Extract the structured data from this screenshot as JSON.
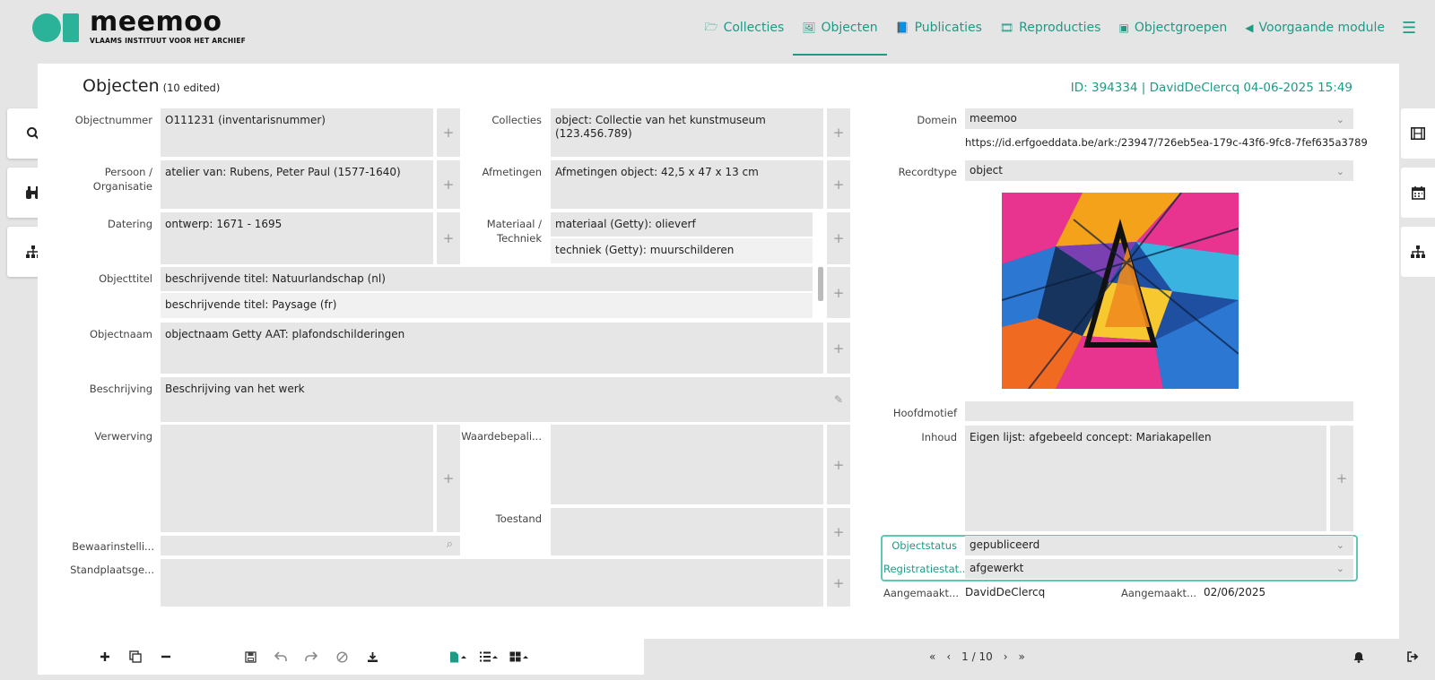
{
  "brand": {
    "name": "meemoo",
    "subtitle": "VLAAMS INSTITUUT VOOR HET ARCHIEF",
    "color": "#2bb39a"
  },
  "nav": {
    "items": [
      {
        "label": "Collecties",
        "icon": "folder-open-icon",
        "glyph": "🗁"
      },
      {
        "label": "Objecten",
        "icon": "image-icon",
        "glyph": "🖼",
        "active": true
      },
      {
        "label": "Publicaties",
        "icon": "book-icon",
        "glyph": "📘"
      },
      {
        "label": "Reproducties",
        "icon": "film-icon",
        "glyph": "🎞"
      },
      {
        "label": "Objectgroepen",
        "icon": "object-group-icon",
        "glyph": "▣"
      },
      {
        "label": "Voorgaande module",
        "icon": "arrow-circle-left-icon",
        "glyph": "◀"
      }
    ],
    "menu_glyph": "☰"
  },
  "card": {
    "title": "Objecten",
    "edited": "(10 edited)",
    "record_info": "ID: 394334 | DavidDeClercq 04-06-2025 15:49"
  },
  "fields": {
    "objectnummer": {
      "label": "Objectnummer",
      "value": "O111231 (inventarisnummer)"
    },
    "persoon": {
      "label1": "Persoon /",
      "label2": "Organisatie",
      "value": "atelier van: Rubens, Peter Paul (1577-1640)"
    },
    "datering": {
      "label": "Datering",
      "value": "ontwerp: 1671 - 1695"
    },
    "collecties": {
      "label": "Collecties",
      "value": "object: Collectie van het kunstmuseum (123.456.789)"
    },
    "afmetingen": {
      "label": "Afmetingen",
      "value": "Afmetingen object: 42,5 x 47 x 13 cm"
    },
    "materiaal": {
      "label1": "Materiaal /",
      "label2": "Techniek",
      "values": [
        "materiaal (Getty): olieverf",
        "techniek (Getty): muurschilderen"
      ]
    },
    "objecttitel": {
      "label": "Objecttitel",
      "values": [
        "beschrijvende titel: Natuurlandschap (nl)",
        "beschrijvende titel: Paysage (fr)"
      ]
    },
    "objectnaam": {
      "label": "Objectnaam",
      "value": "objectnaam Getty AAT: plafondschilderingen"
    },
    "beschrijving": {
      "label": "Beschrijving",
      "value": "Beschrijving van het werk"
    },
    "verwerving": {
      "label": "Verwerving",
      "value": ""
    },
    "waardebepaling": {
      "label": "Waardebepali...",
      "value": ""
    },
    "toestand": {
      "label": "Toestand",
      "value": ""
    },
    "bewaarinstelling": {
      "label": "Bewaarinstelli...",
      "value": ""
    },
    "standplaats": {
      "label": "Standplaatsge...",
      "value": ""
    },
    "domein": {
      "label": "Domein",
      "value": "meemoo",
      "uri": "https://id.erfgoeddata.be/ark:/23947/726eb5ea-179c-43f6-9fc8-7fef635a3789"
    },
    "recordtype": {
      "label": "Recordtype",
      "value": "object"
    },
    "hoofdmotief": {
      "label": "Hoofdmotief",
      "value": ""
    },
    "inhoud": {
      "label": "Inhoud",
      "value": "Eigen lijst: afgebeeld concept: Mariakapellen"
    },
    "objectstatus": {
      "label": "Objectstatus",
      "value": "gepubliceerd"
    },
    "registratiestatus": {
      "label": "Registratiestat...",
      "value": "afgewerkt"
    },
    "aangemaakt_door": {
      "label": "Aangemaakt...",
      "value": "DavidDeClercq"
    },
    "aangemaakt_op": {
      "label": "Aangemaakt...",
      "value": "02/06/2025"
    }
  },
  "glyphs": {
    "plus": "+",
    "dropdown": "⌄",
    "search": "⌕",
    "pencil": "✎"
  },
  "pager": {
    "first": "«",
    "prev": "‹",
    "position": "1 / 10",
    "next": "›",
    "last": "»"
  }
}
